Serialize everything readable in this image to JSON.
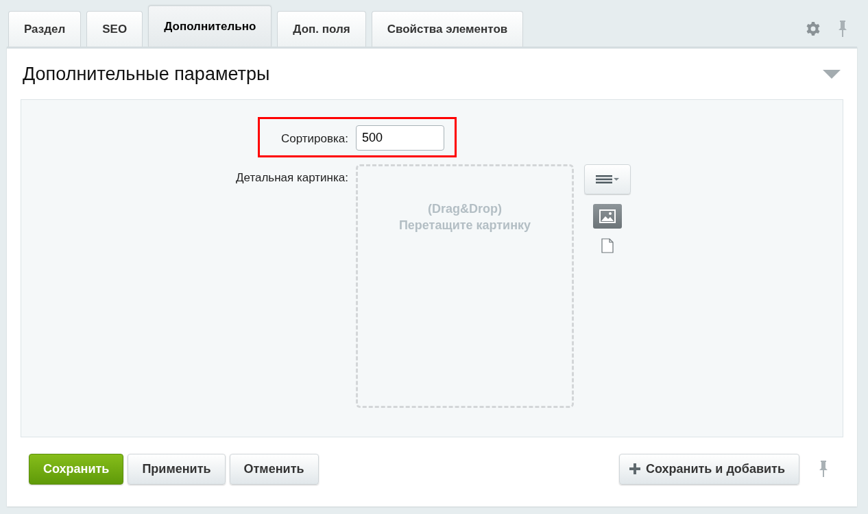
{
  "tabs": [
    {
      "label": "Раздел",
      "selected": false
    },
    {
      "label": "SEO",
      "selected": false
    },
    {
      "label": "Дополнительно",
      "selected": true
    },
    {
      "label": "Доп. поля",
      "selected": false
    },
    {
      "label": "Свойства элементов",
      "selected": false
    }
  ],
  "section": {
    "title": "Дополнительные параметры",
    "expanded": true
  },
  "fields": [
    {
      "kind": "text",
      "label": "Сортировка:",
      "value": "500",
      "highlighted": true
    },
    {
      "kind": "image",
      "label": "Детальная картинка:",
      "drop_hint": "(Drag&Drop)",
      "drop_text": "Перетащите картинку"
    }
  ],
  "buttons": [
    {
      "label": "Сохранить",
      "kind": "primary"
    },
    {
      "label": "Применить",
      "kind": "default"
    },
    {
      "label": "Отменить",
      "kind": "default"
    }
  ],
  "add_button": {
    "label": "Сохранить и добавить"
  }
}
